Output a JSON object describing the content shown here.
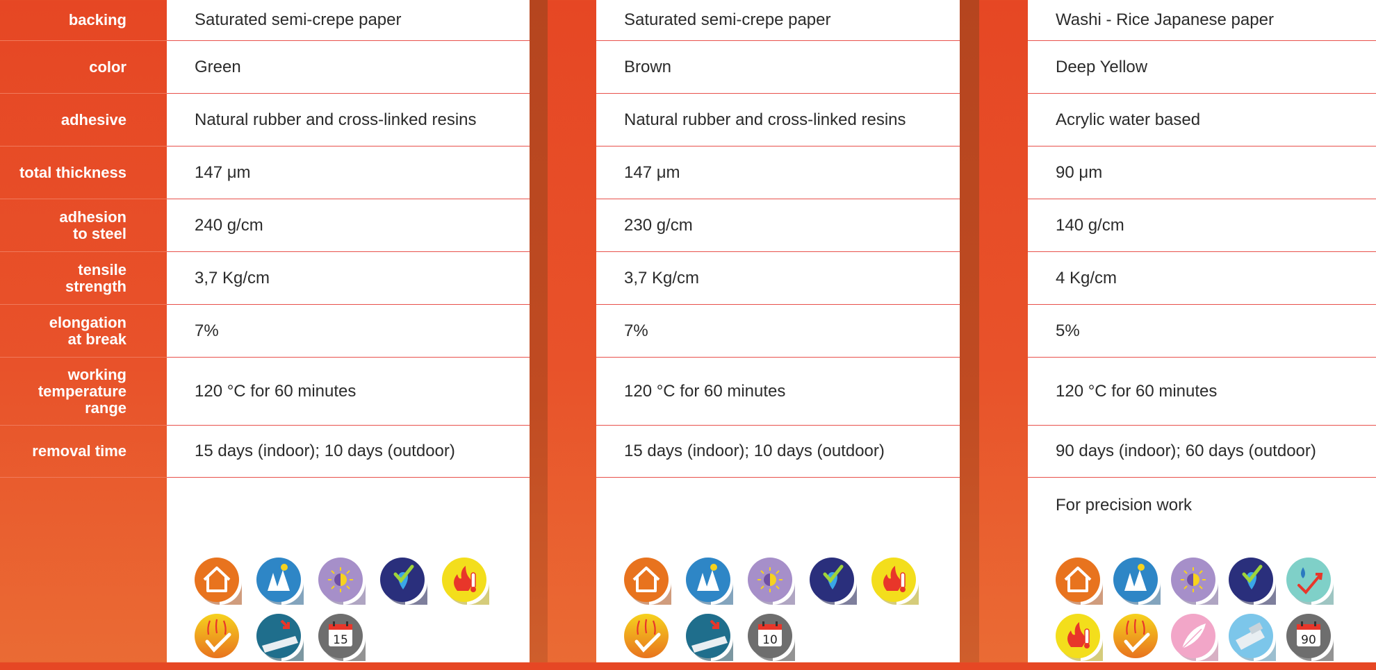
{
  "labels": [
    "backing",
    "color",
    "adhesive",
    "total thickness",
    "adhesion\nto steel",
    "tensile\nstrength",
    "elongation\nat break",
    "working\ntemperature\nrange",
    "removal time"
  ],
  "products": [
    {
      "values": [
        "Saturated semi-crepe paper",
        "Green",
        "Natural rubber and cross-linked resins",
        "147 μm",
        "240 g/cm",
        "3,7 Kg/cm",
        "7%",
        "120 °C for 60 minutes",
        "15 days (indoor);  10 days (outdoor)"
      ],
      "note": "",
      "icons": [
        "indoor-house-icon",
        "outdoor-trees-sun-icon",
        "uv-resistance-icon",
        "water-resistance-icon",
        "heat-resistance-icon",
        "high-temp-arrows-icon",
        "clean-removal-icon",
        "calendar-15-icon"
      ],
      "calendar_days": "15"
    },
    {
      "values": [
        "Saturated semi-crepe paper",
        "Brown",
        "Natural rubber and cross-linked resins",
        "147 μm",
        "230 g/cm",
        "3,7 Kg/cm",
        "7%",
        "120 °C for 60 minutes",
        "15 days (indoor);  10 days (outdoor)"
      ],
      "note": "",
      "icons": [
        "indoor-house-icon",
        "outdoor-trees-sun-icon",
        "uv-resistance-icon",
        "water-resistance-icon",
        "heat-resistance-icon",
        "high-temp-arrows-icon",
        "clean-removal-icon",
        "calendar-10-icon"
      ],
      "calendar_days": "10"
    },
    {
      "values": [
        "Washi - Rice Japanese paper",
        "Deep Yellow",
        "Acrylic water based",
        "90 μm",
        "140 g/cm",
        "4 Kg/cm",
        "5%",
        "120 °C for 60 minutes",
        "90 days (indoor); 60 days (outdoor)"
      ],
      "note": "For precision work",
      "icons": [
        "indoor-house-icon",
        "outdoor-trees-sun-icon",
        "uv-resistance-icon",
        "water-resistance-icon",
        "water-check-icon",
        "heat-resistance-icon",
        "high-temp-arrows-icon",
        "feather-light-icon",
        "tape-dispenser-icon",
        "calendar-90-icon"
      ],
      "calendar_days": "90"
    }
  ],
  "colors": {
    "orange": "#e64724",
    "divider": "#c04b22",
    "row_border": "#e8504a"
  }
}
